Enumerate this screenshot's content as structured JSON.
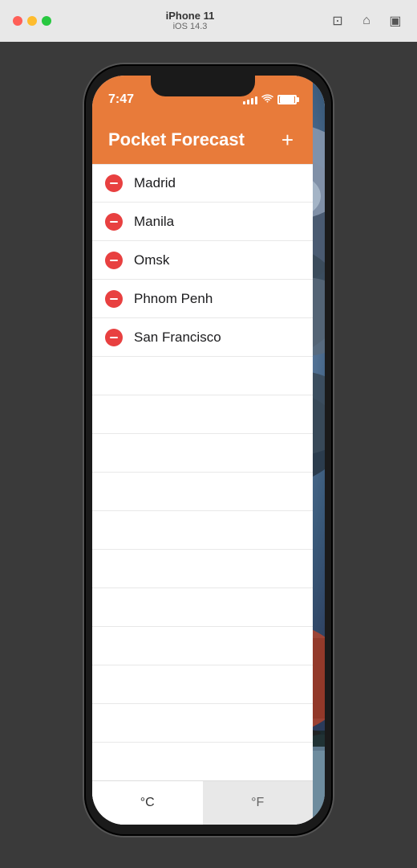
{
  "desktop": {
    "device_name": "iPhone 11",
    "os_version": "iOS 14.3",
    "traffic_lights": [
      "close",
      "minimize",
      "maximize"
    ]
  },
  "status_bar": {
    "time": "7:47"
  },
  "app": {
    "title": "Pocket Forecast",
    "add_button_label": "+"
  },
  "cities": [
    {
      "name": "Madrid"
    },
    {
      "name": "Manila"
    },
    {
      "name": "Omsk"
    },
    {
      "name": "Phnom Penh"
    },
    {
      "name": "San Francisco"
    }
  ],
  "temp_toggle": {
    "celsius_label": "°C",
    "fahrenheit_label": "°F",
    "active": "celsius"
  },
  "empty_rows_count": 12
}
